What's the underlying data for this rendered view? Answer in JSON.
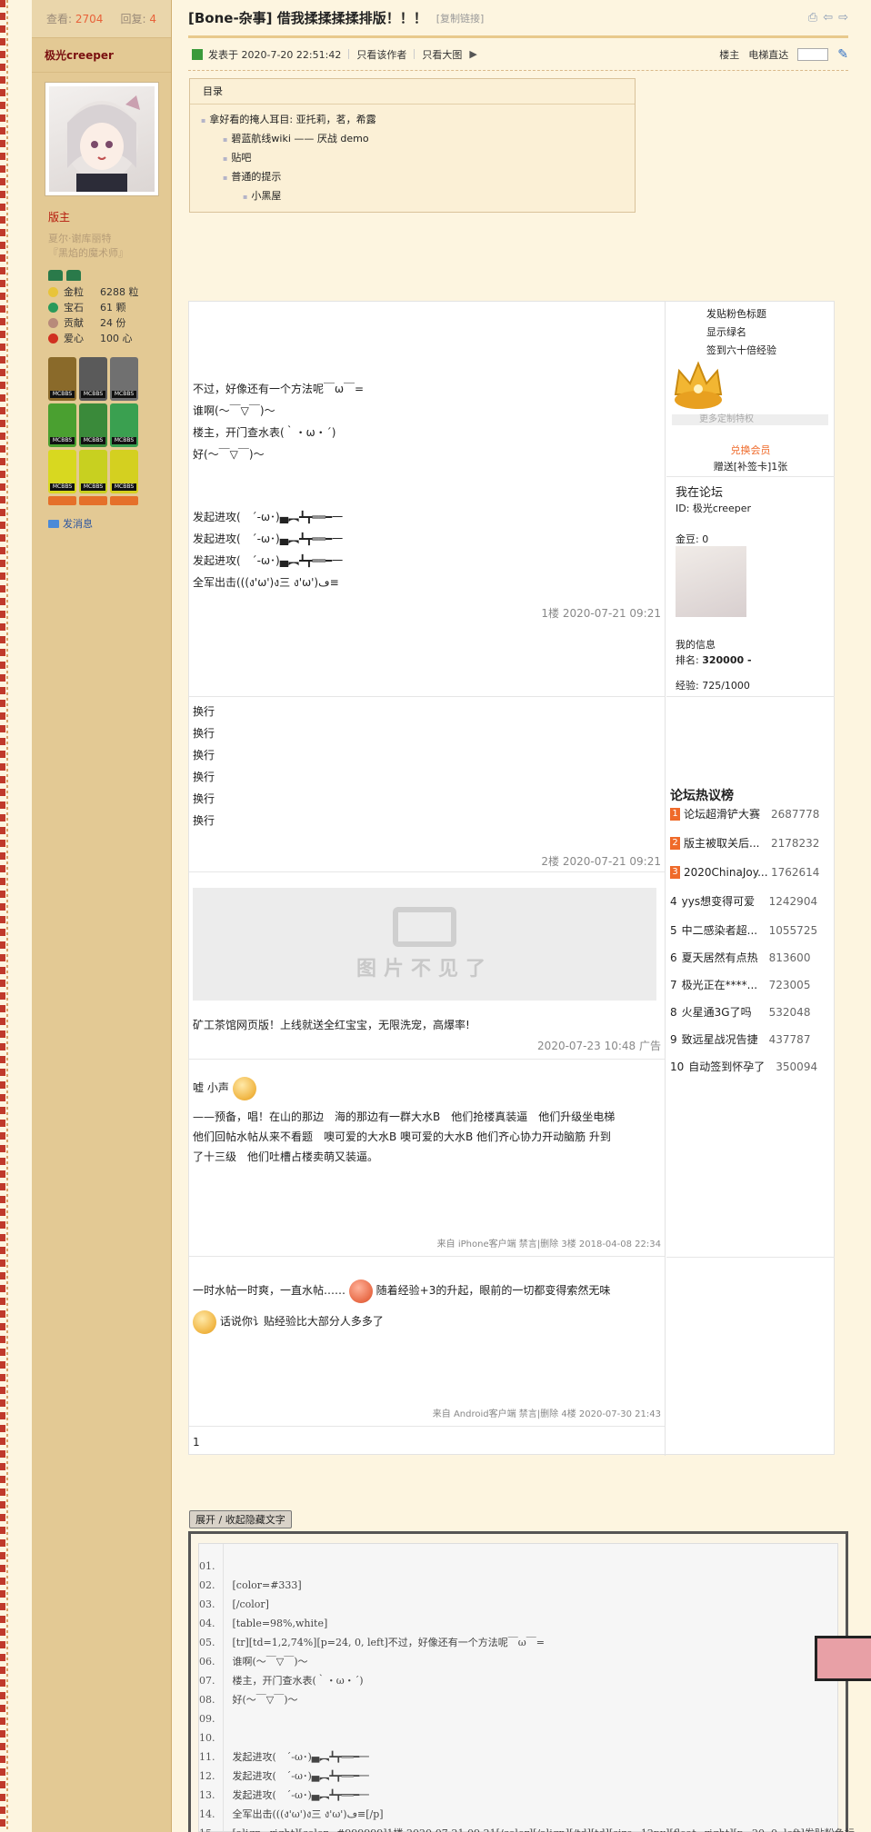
{
  "thread": {
    "views_label": "查看:",
    "views": "2704",
    "replies_label": "回复:",
    "replies": "4",
    "title": "[Bone-杂事] 借我揉揉揉揉排版！！！",
    "copy_link": "[复制链接]"
  },
  "author": {
    "name": "极光creeper",
    "role": "版主",
    "subtitle_1": "夏尔·谢库丽特",
    "subtitle_2": "『黑焰的魔术师』",
    "props": [
      {
        "label": "金粒",
        "value": "6288 粒",
        "color": "#e8c43a"
      },
      {
        "label": "宝石",
        "value": "61 颗",
        "color": "#2a9a5a"
      },
      {
        "label": "贡献",
        "value": "24 份",
        "color": "#b88a7a"
      },
      {
        "label": "爱心",
        "value": "100 心",
        "color": "#d03020"
      }
    ],
    "badge_tag": "MCBBS",
    "message": "发消息"
  },
  "meta": {
    "posted": "发表于 2020-7-20 22:51:42",
    "only_author": "只看该作者",
    "big_image": "只看大图",
    "floor": "楼主",
    "jump": "电梯直达"
  },
  "toc": {
    "heading": "目录",
    "items": [
      "拿好看的掩人耳目: 亚托莉，茗，希露",
      "碧蓝航线wiki —— 厌战 demo",
      "贴吧",
      "普通的提示",
      "小黑屋"
    ]
  },
  "posts": {
    "p1": [
      "不过，好像还有一个方法呢￣ω￣=",
      "谁啊(〜￣▽￣)〜",
      "楼主，开门查水表(｀・ω・´)",
      "好(〜￣▽￣)〜",
      "发起进攻(　´-ω･)▄︻┻┳══━一",
      "发起进攻(　´-ω･)▄︻┻┳══━一",
      "发起进攻(　´-ω･)▄︻┻┳══━一",
      "全军出击(((ง'ω')ง三 ง'ω')ڡ≡"
    ],
    "p1_floor": "1楼 2020-07-21 09:21",
    "p2": [
      "换行",
      "换行",
      "换行",
      "换行",
      "换行",
      "换行"
    ],
    "p2_floor": "2楼 2020-07-21 09:21",
    "ad_image_text": "图片不见了",
    "ad_text": "矿工茶馆网页版！上线就送全红宝宝，无限洗宠，高爆率!",
    "ad_floor": "2020-07-23 10:48 广告",
    "p3_line1": "嘘 小声",
    "p3_line2": "——预备，唱！在山的那边　海的那边有一群大水B　他们抢楼真装逼　他们升级坐电梯",
    "p3_line3": "他们回帖水帖从来不看题　噢可爱的大水B 噢可爱的大水B 他们齐心协力开动脑筋 升到",
    "p3_line4": "了十三级　他们吐槽占楼卖萌又装逼。",
    "p3_floor": "来自 iPhone客户端 禁言|删除 3楼 2018-04-08 22:34",
    "p4_line1a": "一时水帖一时爽，一直水帖……",
    "p4_line1b": "随着经验+3的升起，眼前的一切都变得索然无味",
    "p4_line2": "话说你讠贴经验比大部分人多多了",
    "p4_floor": "来自 Android客户端 禁言|删除 4楼 2020-07-30 21:43",
    "page": "1"
  },
  "right": {
    "links": [
      "发贴粉色标题",
      "显示绿名",
      "签到六十倍经验"
    ],
    "more_vip": "更多定制特权",
    "buy_vip": "兑换会员",
    "gift_card": "赠送[补签卡]1张",
    "me_title": "我在论坛",
    "me_id": "ID:  极光creeper",
    "me_gold": "金豆: 0",
    "me_info": "我的信息",
    "me_rank_label": "排名:",
    "me_rank": "320000 -",
    "me_exp": "经验: 725/1000",
    "hot_title": "论坛热议榜",
    "hot": [
      {
        "n": "1",
        "t": "论坛超滑铲大赛",
        "v": "2687778",
        "c": "#ef6a2a"
      },
      {
        "n": "2",
        "t": "版主被取关后...",
        "v": "2178232",
        "c": "#ef6a2a"
      },
      {
        "n": "3",
        "t": "2020ChinaJoy...",
        "v": "1762614",
        "c": "#ef6a2a"
      },
      {
        "n": "4",
        "t": "yys想变得可爱",
        "v": "1242904",
        "c": ""
      },
      {
        "n": "5",
        "t": "中二感染者超...",
        "v": "1055725",
        "c": ""
      },
      {
        "n": "6",
        "t": "夏天居然有点热",
        "v": "813600",
        "c": ""
      },
      {
        "n": "7",
        "t": "极光正在****...",
        "v": "723005",
        "c": ""
      },
      {
        "n": "8",
        "t": "火星通3G了吗",
        "v": "532048",
        "c": ""
      },
      {
        "n": "9",
        "t": "致远星战况告捷",
        "v": "437787",
        "c": ""
      },
      {
        "n": "10",
        "t": "自动签到怀孕了",
        "v": "350094",
        "c": ""
      }
    ]
  },
  "hidden": {
    "toggle": "展开 / 收起隐藏文字",
    "line_numbers": [
      "01.",
      "02.",
      "03.",
      "04.",
      "05.",
      "06.",
      "07.",
      "08.",
      "09.",
      "10.",
      "11.",
      "12.",
      "13.",
      "14.",
      "15."
    ],
    "lines": [
      "",
      "[color=#333]",
      "[/color]",
      "[table=98%,white]",
      "[tr][td=1,2,74%][p=24, 0, left]不过，好像还有一个方法呢￣ω￣=",
      "谁啊(〜￣▽￣)〜",
      "楼主，开门查水表(｀・ω・´)",
      "好(〜￣▽￣)〜",
      "",
      "",
      "发起进攻(　´-ω･)▄︻┻┳══━一",
      "发起进攻(　´-ω･)▄︻┻┳══━一",
      "发起进攻(　´-ω･)▄︻┻┳══━一",
      "全军出击(((ง'ω')ง三 ง'ω')ڡ≡[/p]",
      "[align=right][color=#999999]1楼 2020-07-21 09:21[/color][/align][/td][td][size=12px][float=right][p=20, 0, left]发贴粉色标"
    ]
  }
}
